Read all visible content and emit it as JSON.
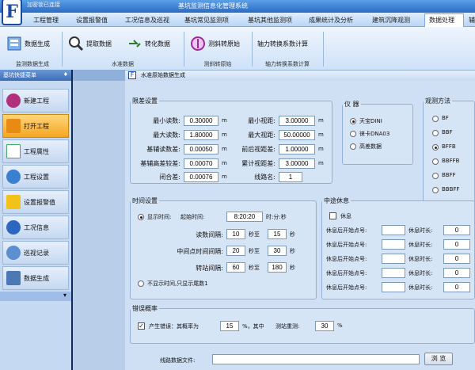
{
  "app": {
    "title": "基坑监测信息化管理系统",
    "status": "加密锁已连接",
    "logo": "F"
  },
  "menu": [
    "工程管理",
    "设置报警值",
    "工况信息及巡视",
    "基坑常见监测项",
    "基坑其他监测项",
    "成果统计及分析",
    "建筑沉降观测",
    "数据处理",
    "辅"
  ],
  "ribbon": {
    "buttons": [
      "数据生成",
      "提取数据",
      "转化数据",
      "测斜转原始",
      "轴力转换系数计算"
    ],
    "groups": [
      "监测数据生成",
      "水准数据",
      "测斜转原始",
      "轴力转换系数计算"
    ]
  },
  "sidebar": {
    "title": "基坑快捷菜单",
    "pin": "♦",
    "items": [
      "新建工程",
      "打开工程",
      "工程属性",
      "工程设置",
      "设置报警值",
      "工况信息",
      "巡视记录",
      "数据生成"
    ],
    "more": "▾"
  },
  "tab": {
    "title": "水准原始数据生成"
  },
  "tolerance": {
    "legend": "限差设置",
    "left": [
      {
        "label": "最小读数:",
        "value": "0.30000",
        "unit": "m"
      },
      {
        "label": "最大读数:",
        "value": "1.80000",
        "unit": "m"
      },
      {
        "label": "基辅读数差:",
        "value": "0.00050",
        "unit": "m"
      },
      {
        "label": "基辅高差较差:",
        "value": "0.00070",
        "unit": "m"
      },
      {
        "label": "闭合差:",
        "value": "0.00076",
        "unit": "m"
      }
    ],
    "right": [
      {
        "label": "最小视距:",
        "value": "3.00000",
        "unit": "m"
      },
      {
        "label": "最大视距:",
        "value": "50.00000",
        "unit": "m"
      },
      {
        "label": "前后视距差:",
        "value": "1.00000",
        "unit": "m"
      },
      {
        "label": "累计视距差:",
        "value": "3.00000",
        "unit": "m"
      },
      {
        "label": "线路名:",
        "value": "1",
        "unit": ""
      }
    ]
  },
  "instrument": {
    "legend": "仪 器",
    "options": [
      "天宝DINI",
      "徕卡DNA03",
      "高差数据"
    ],
    "selected": 0
  },
  "method": {
    "legend": "观测方法",
    "options": [
      "BF",
      "BBF",
      "BFFB",
      "BBFFB",
      "BBFF",
      "BBBFF"
    ],
    "selected": 2
  },
  "time": {
    "legend": "时间设置",
    "show_label": "显示时间:",
    "start_label": "起始时间:",
    "start_value": "8:20:20",
    "format": "时:分:秒",
    "rows": [
      {
        "label": "读数间隔:",
        "a": "10",
        "mid": "秒至",
        "b": "15",
        "end": "秒"
      },
      {
        "label": "中间点时间间隔:",
        "a": "20",
        "mid": "秒至",
        "b": "30",
        "end": "秒"
      },
      {
        "label": "转站间隔:",
        "a": "60",
        "mid": "秒至",
        "b": "180",
        "end": "秒"
      }
    ],
    "hide_label": "不显示时间,只显示尾数1"
  },
  "rest": {
    "legend": "中途休息",
    "check_label": "休息",
    "start_label": "休息后开始点号:",
    "dur_label": "休息时长:",
    "value": "0",
    "rows": 5
  },
  "error": {
    "legend": "错误概率",
    "label": "产生错误：其概率为",
    "value": "15",
    "mid": "%，其中",
    "label2": "测站重测:",
    "value2": "30",
    "unit": "%"
  },
  "file": {
    "label": "线路数据文件:",
    "value": "",
    "browse": "浏 览"
  }
}
